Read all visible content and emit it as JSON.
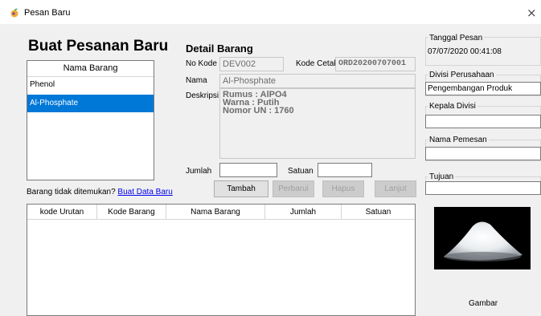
{
  "window": {
    "title": "Pesan Baru",
    "close_glyph": "×",
    "icon": "app-icon"
  },
  "heading": "Buat Pesanan Baru",
  "item_list": {
    "header": "Nama Barang",
    "items": [
      {
        "label": "Phenol",
        "selected": false
      },
      {
        "label": "Al-Phosphate",
        "selected": true
      }
    ]
  },
  "not_found": {
    "text": "Barang tidak ditemukan?",
    "link": "Buat Data Baru"
  },
  "detail": {
    "title": "Detail Barang",
    "kode_label": "No Kode",
    "kode_value": "DEV002",
    "kode_cetak_label": "Kode Cetak",
    "kode_cetak_value": "ORD20200707001",
    "nama_label": "Nama",
    "nama_value": "Al-Phosphate",
    "deskripsi_label": "Deskripsi",
    "deskripsi_lines": [
      "Rumus : AlPO4",
      "Warna : Putih",
      "Nomor UN : 1760"
    ],
    "jumlah_label": "Jumlah",
    "jumlah_value": "",
    "satuan_label": "Satuan",
    "satuan_value": ""
  },
  "buttons": {
    "tambah": "Tambah",
    "perbarui": "Perbarui",
    "hapus": "Hapus",
    "lanjut": "Lanjut"
  },
  "grid": {
    "columns": [
      "kode Urutan",
      "Kode Barang",
      "Nama Barang",
      "Jumlah",
      "Satuan"
    ],
    "rows": []
  },
  "side": {
    "tanggal_label": "Tanggal Pesan",
    "tanggal_value": "07/07/2020 00:41:08",
    "divisi_label": "Divisi Perusahaan",
    "divisi_value": "Pengembangan Produk",
    "kepala_label": "Kepala Divisi",
    "kepala_value": "",
    "pemesan_label": "Nama Pemesan",
    "pemesan_value": "",
    "tujuan_label": "Tujuan",
    "tujuan_value": "",
    "image_caption": "Gambar"
  },
  "colors": {
    "selection": "#0078d7",
    "link": "#0000ee",
    "form_bg": "#f0f0f0"
  }
}
